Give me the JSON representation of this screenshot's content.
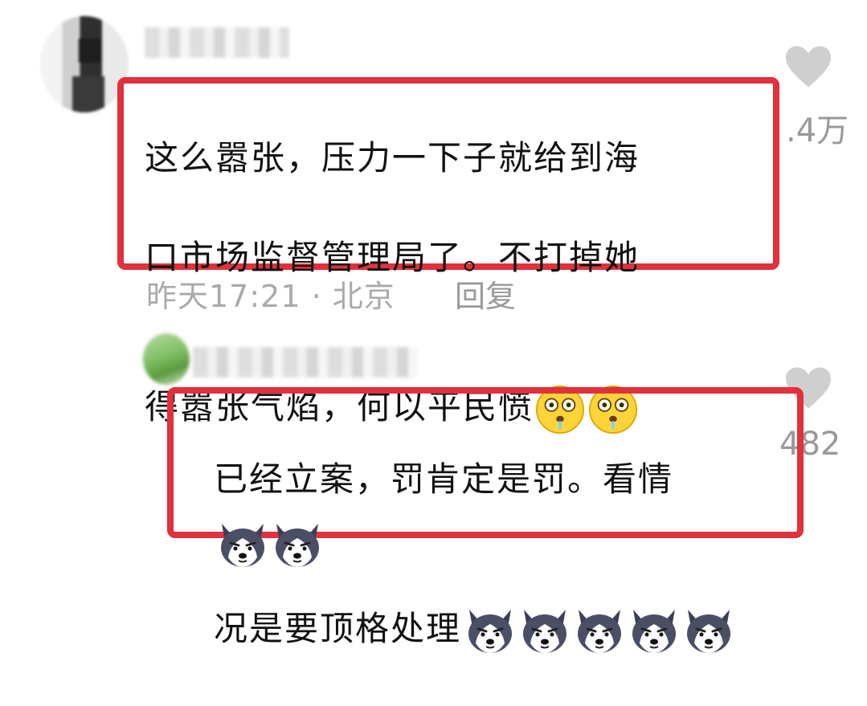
{
  "comments": [
    {
      "text_lines": [
        "这么嚣张，压力一下子就给到海",
        "口市场监督管理局了。不打掉她",
        "得嚣张气焰，何以平民愤"
      ],
      "emoji_name": "drooling-face-emoji",
      "emoji_count": 2,
      "timestamp": "昨天17:21 · 北京",
      "reply_label": "回复",
      "like_count": ".4万"
    },
    {
      "text_lines": [
        "已经立案，罚肯定是罚。看情",
        "况是要顶格处理"
      ],
      "emoji_name": "husky-dog-emoji",
      "emoji_count": 7,
      "like_count": "482"
    }
  ],
  "colors": {
    "highlight_border": "#e0313c",
    "meta_text": "#aaaaaa",
    "heart": "#cfcfcf"
  }
}
